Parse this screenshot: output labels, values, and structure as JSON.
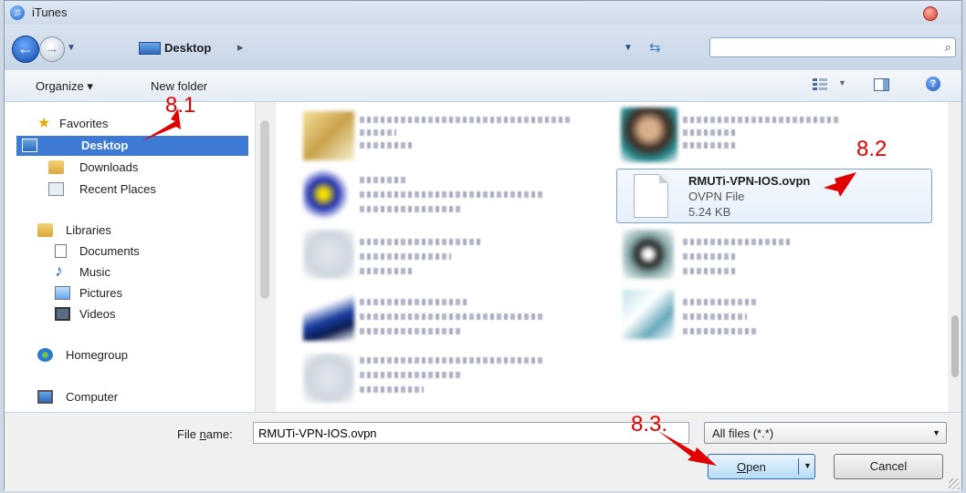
{
  "window": {
    "title": "iTunes"
  },
  "address": {
    "location": "Desktop",
    "separator": "▸"
  },
  "toolbar": {
    "organize": "Organize ▾",
    "new_folder": "New folder"
  },
  "nav": {
    "favorites": "Favorites",
    "desktop": "Desktop",
    "downloads": "Downloads",
    "recent": "Recent Places",
    "libraries": "Libraries",
    "documents": "Documents",
    "music": "Music",
    "pictures": "Pictures",
    "videos": "Videos",
    "homegroup": "Homegroup",
    "computer": "Computer"
  },
  "selected_file": {
    "name": "RMUTi-VPN-IOS.ovpn",
    "type": "OVPN File",
    "size": "5.24 KB"
  },
  "bottom": {
    "filename_label_prefix": "File ",
    "filename_label_underlined": "n",
    "filename_label_suffix": "ame:",
    "filename_value": "RMUTi-VPN-IOS.ovpn",
    "filter_value": "All files (*.*)",
    "open_prefix": "",
    "open_underlined": "O",
    "open_suffix": "pen",
    "cancel": "Cancel"
  },
  "annotations": {
    "a1": "8.1",
    "a2": "8.2",
    "a3": "8.3."
  },
  "colors": {
    "selection": "#3d7ad6",
    "annotation": "#e00000"
  }
}
